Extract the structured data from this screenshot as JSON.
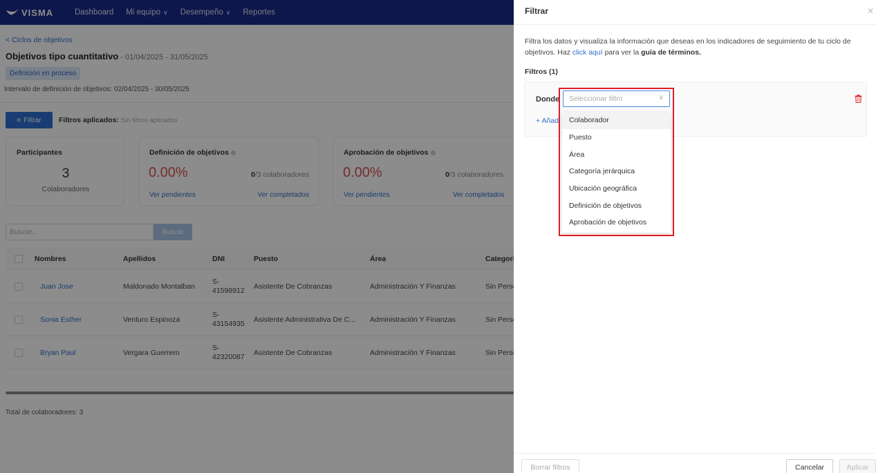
{
  "app": {
    "logo_text": "VISMA"
  },
  "nav": {
    "items": [
      {
        "label": "Dashboard",
        "has_dropdown": false
      },
      {
        "label": "Mi equipo",
        "has_dropdown": true
      },
      {
        "label": "Desempeño",
        "has_dropdown": true
      },
      {
        "label": "Reportes",
        "has_dropdown": false
      }
    ]
  },
  "page": {
    "back_link": "< Ciclos de objetivos",
    "title": "Objetivos tipo cuantitativo",
    "dates": " - 01/04/2025 - 31/05/2025",
    "status": "Definición en proceso",
    "interval": "Intervalo de definición de objetivos: 02/04/2025 - 30/05/2025"
  },
  "toolbar": {
    "filter_button": "Filtrar",
    "filters_applied_label": "Filtros aplicados:",
    "filters_applied_value": "Sin filtros aplicados"
  },
  "cards": {
    "participants": {
      "title": "Participantes",
      "count": "3",
      "label": "Colaboradores"
    },
    "definition": {
      "title": "Definición de objetivos",
      "percent": "0.00%",
      "count_done": "0",
      "count_total": "/3 colaboradores",
      "link_pending": "Ver pendientes",
      "link_done": "Ver completados"
    },
    "approval": {
      "title": "Aprobación de objetivos",
      "percent": "0.00%",
      "count_done": "0",
      "count_total": "/3 colaboradores",
      "link_pending": "Ver pendientes",
      "link_done": "Ver completados"
    }
  },
  "search": {
    "placeholder": "Buscar...",
    "button": "Buscar"
  },
  "table": {
    "headers": {
      "nombres": "Nombres",
      "apellidos": "Apellidos",
      "dni": "DNI",
      "puesto": "Puesto",
      "area": "Área",
      "categoria": "Categoría"
    },
    "rows": [
      {
        "nombres": "Juan Jose",
        "apellidos": "Maldonado Montalban",
        "dni": "S-41598912",
        "puesto": "Asistente De Cobranzas",
        "area": "Administración Y Finanzas",
        "categoria": "Sin Personal"
      },
      {
        "nombres": "Sonia Esther",
        "apellidos": "Venturo Espinoza",
        "dni": "S-43154935",
        "puesto": "Asistente Administrativa De C...",
        "area": "Administración Y Finanzas",
        "categoria": "Sin Personal"
      },
      {
        "nombres": "Bryan Paul",
        "apellidos": "Vergara Guerrero",
        "dni": "S-42320087",
        "puesto": "Asistente De Cobranzas",
        "area": "Administración Y Finanzas",
        "categoria": "Sin Personal"
      }
    ]
  },
  "total": "Total de colaboradores: 3",
  "drawer": {
    "title": "Filtrar",
    "desc_before": "Filtra los datos y visualiza la información que deseas en los indicadores de seguimiento de tu ciclo de objetivos. Haz ",
    "desc_link": "click aquí",
    "desc_middle": " para ver la ",
    "desc_bold": "guía de términos.",
    "filters_count": "Filtros (1)",
    "donde_label": "Donde",
    "select_placeholder": "Seleccionar filtro",
    "add_link": "+ Añadir filtro",
    "options": [
      "Colaborador",
      "Puesto",
      "Área",
      "Categoría jerárquica",
      "Ubicación geográfica",
      "Definición de objetivos",
      "Aprobación de objetivos"
    ],
    "btn_clear": "Borrar filtros",
    "btn_cancel": "Cancelar",
    "btn_apply": "Aplicar"
  },
  "colors": {
    "nav_bg": "#1a2a8a",
    "primary": "#2e6fd0",
    "link": "#2f6fc9",
    "danger": "#d9534f",
    "highlight": "#e01b24"
  }
}
